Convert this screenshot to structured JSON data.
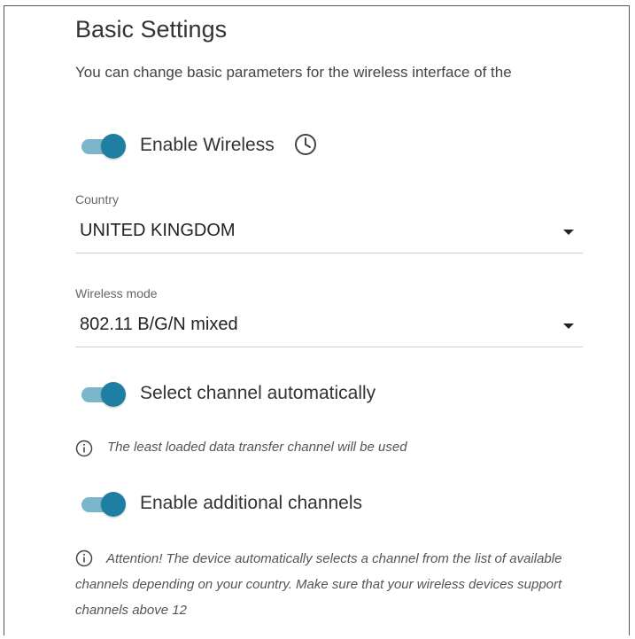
{
  "header": {
    "title": "Basic Settings",
    "description": "You can change basic parameters for the wireless interface of the"
  },
  "enable_wireless": {
    "label": "Enable Wireless",
    "state": "on",
    "schedule_icon": "clock-icon"
  },
  "country": {
    "label": "Country",
    "value": "UNITED KINGDOM"
  },
  "wireless_mode": {
    "label": "Wireless mode",
    "value": "802.11 B/G/N mixed"
  },
  "auto_channel": {
    "label": "Select channel automatically",
    "state": "on",
    "hint": "The least loaded data transfer channel will be used"
  },
  "additional_channels": {
    "label": "Enable additional channels",
    "state": "on",
    "note": "Attention! The device automatically selects a channel from the list of available channels depending on your country. Make sure that your wireless devices support channels above 12"
  },
  "colors": {
    "accent": "#1f7fa3",
    "track": "#7bb6ca",
    "divider": "#cfcfcf"
  }
}
